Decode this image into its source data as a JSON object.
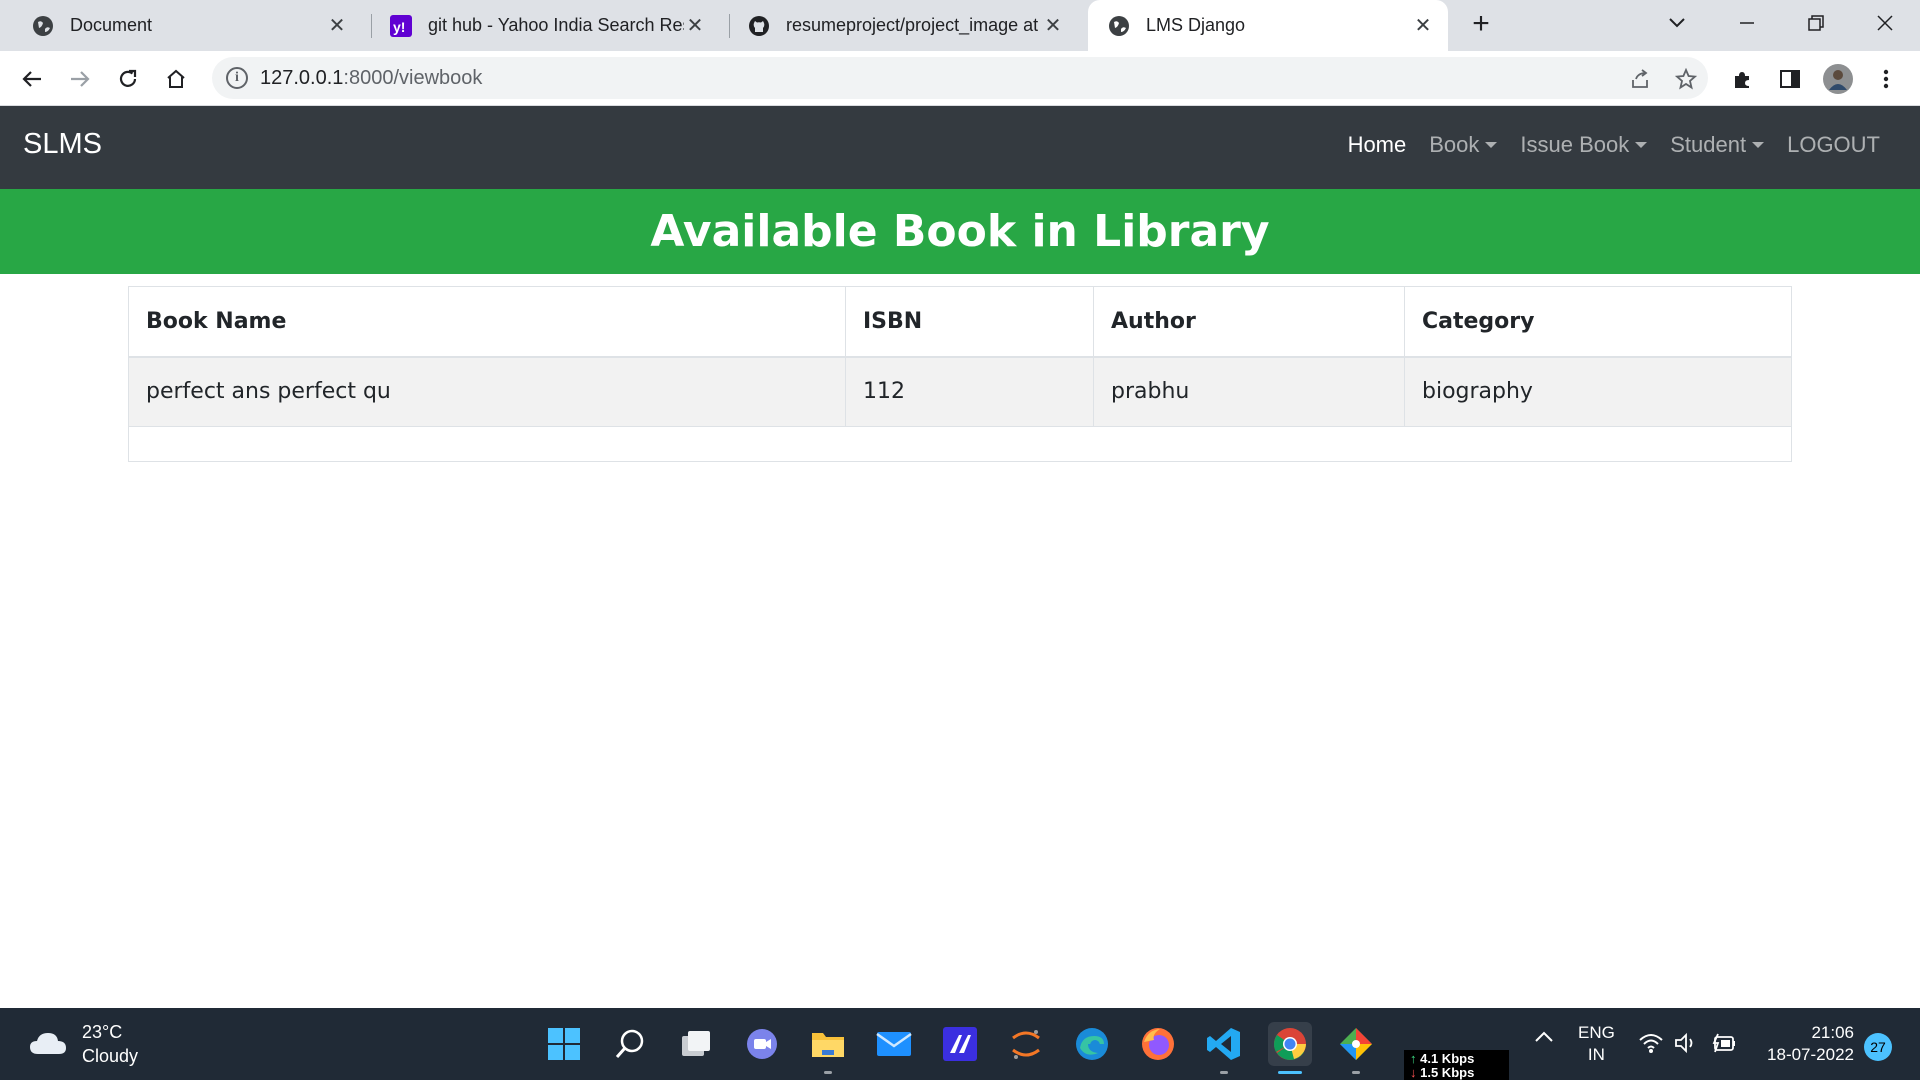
{
  "browser": {
    "tabs": [
      {
        "title": "Document",
        "icon": "globe-icon"
      },
      {
        "title": "git hub - Yahoo India Search Resu",
        "icon": "yahoo-icon"
      },
      {
        "title": "resumeproject/project_image at",
        "icon": "github-icon"
      },
      {
        "title": "LMS Django",
        "icon": "globe-icon"
      }
    ],
    "url_host": "127.0.0.1",
    "url_path": ":8000/viewbook"
  },
  "navbar": {
    "brand": "SLMS",
    "links": [
      {
        "label": "Home",
        "active": true,
        "dropdown": false
      },
      {
        "label": "Book",
        "active": false,
        "dropdown": true
      },
      {
        "label": "Issue Book",
        "active": false,
        "dropdown": true
      },
      {
        "label": "Student",
        "active": false,
        "dropdown": true
      },
      {
        "label": "LOGOUT",
        "active": false,
        "dropdown": false
      }
    ]
  },
  "banner": {
    "title": "Available Book in Library"
  },
  "table": {
    "headers": [
      "Book Name",
      "ISBN",
      "Author",
      "Category"
    ],
    "rows": [
      [
        "perfect ans perfect qu",
        "112",
        "prabhu",
        "biography"
      ]
    ]
  },
  "taskbar": {
    "weather_temp": "23°C",
    "weather_desc": "Cloudy",
    "net_up": "4.1 Kbps",
    "net_down": "1.5 Kbps",
    "lang_1": "ENG",
    "lang_2": "IN",
    "time": "21:06",
    "date": "18-07-2022",
    "notification_count": "27"
  },
  "colors": {
    "navbar_bg": "#343a40",
    "banner_bg": "#28a745",
    "taskbar_bg": "#202a36",
    "accent": "#4cc2ff"
  }
}
